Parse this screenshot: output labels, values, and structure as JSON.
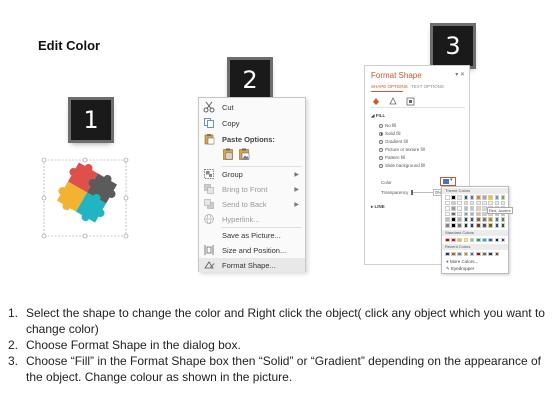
{
  "title": "Edit Color",
  "steps": [
    "1",
    "2",
    "3"
  ],
  "context_menu": {
    "items": [
      {
        "label": "Cut",
        "icon": "scissors-icon",
        "enabled": true
      },
      {
        "label": "Copy",
        "icon": "copy-icon",
        "enabled": true
      },
      {
        "label": "Paste Options:",
        "icon": "paste-icon",
        "enabled": true
      },
      {
        "label": "Group",
        "icon": "group-icon",
        "enabled": true,
        "submenu": true
      },
      {
        "label": "Bring to Front",
        "icon": "bring-front-icon",
        "enabled": false,
        "submenu": true
      },
      {
        "label": "Send to Back",
        "icon": "send-back-icon",
        "enabled": false,
        "submenu": true
      },
      {
        "label": "Hyperlink...",
        "icon": "hyperlink-icon",
        "enabled": false
      },
      {
        "label": "Save as Picture...",
        "icon": "",
        "enabled": true
      },
      {
        "label": "Size and Position...",
        "icon": "size-position-icon",
        "enabled": true
      },
      {
        "label": "Format Shape...",
        "icon": "format-shape-icon",
        "enabled": true,
        "highlighted": true
      }
    ]
  },
  "format_shape": {
    "title": "Format Shape",
    "tabs": [
      "SHAPE OPTIONS",
      "TEXT OPTIONS"
    ],
    "fill_section": "FILL",
    "fill_options": [
      "No fill",
      "Solid fill",
      "Gradient fill",
      "Picture or texture fill",
      "Pattern fill",
      "Slide background fill"
    ],
    "selected_fill": "Solid fill",
    "color_label": "Color",
    "transparency_label": "Transparency",
    "transparency_value": "0%",
    "line_section": "LINE"
  },
  "color_dropdown": {
    "theme_label": "Theme Colors",
    "standard_label": "Standard Colors",
    "recent_label": "Recent Colors",
    "more_colors": "More Colors...",
    "eyedropper": "Eyedropper",
    "tooltip": "Red, Accent",
    "theme_top_row": [
      "#ffffff",
      "#000000",
      "#e7e6e6",
      "#44546a",
      "#4472c4",
      "#ed7d31",
      "#a5a5a5",
      "#ffc000",
      "#5b9bd5",
      "#70ad47"
    ],
    "standard_colors": [
      "#c00000",
      "#ff0000",
      "#ffc000",
      "#ffff00",
      "#92d050",
      "#00b050",
      "#00b0f0",
      "#0070c0",
      "#002060",
      "#7030a0"
    ],
    "recent_colors": [
      "#1f3864",
      "#c55a11",
      "#7f7f7f",
      "#bf9000",
      "#2e75b6",
      "#c00000",
      "#548235",
      "#203864",
      "#843c0c"
    ]
  },
  "puzzle_colors": {
    "red": "#e0504a",
    "gray": "#5b5b5b",
    "yellow": "#f2b430",
    "teal": "#1fb5c1"
  },
  "instructions": [
    {
      "num": "1.",
      "text": "Select the shape to change the color and Right click the object( click any object which you want to change color)"
    },
    {
      "num": "2.",
      "text": "Choose Format Shape in the dialog box."
    },
    {
      "num": "3.",
      "text": "Choose “Fill” in the Format Shape box then “Solid” or “Gradient” depending on the appearance of the object. Change colour as shown in the picture."
    }
  ]
}
